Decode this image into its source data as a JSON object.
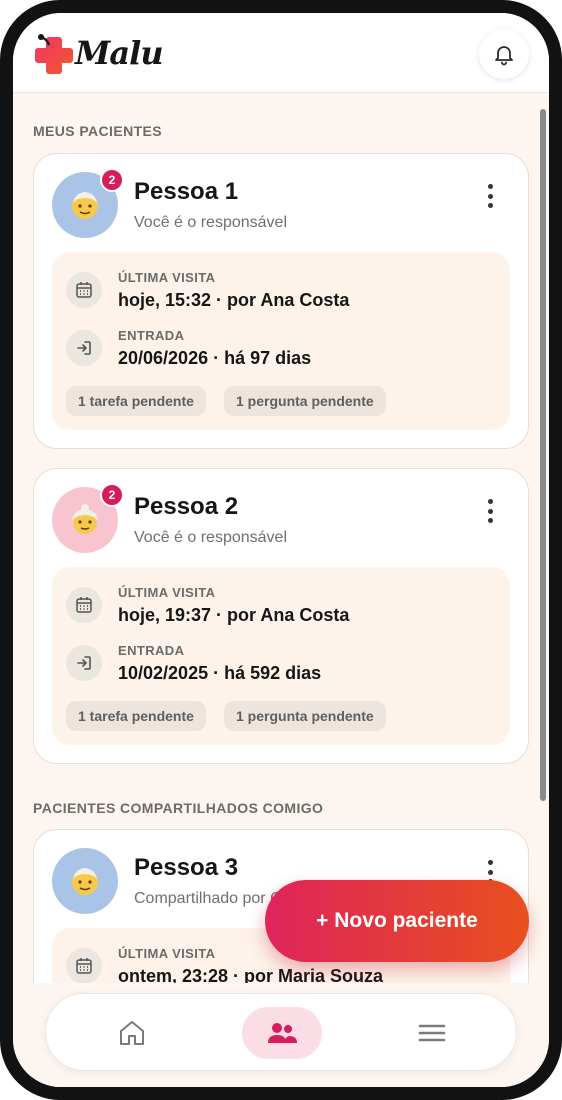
{
  "app": {
    "name": "Malu"
  },
  "sections": {
    "mine": "MEUS PACIENTES",
    "shared": "PACIENTES COMPARTILHADOS COMIGO"
  },
  "patients": [
    {
      "name": "Pessoa 1",
      "subtitle": "Você é o responsável",
      "badge": "2",
      "last_visit_label": "ÚLTIMA VISITA",
      "last_visit_value": "hoje, 15:32 · por Ana Costa",
      "entry_label": "ENTRADA",
      "entry_value": "20/06/2026 · há 97 dias",
      "chip_tasks": "1 tarefa pendente",
      "chip_questions": "1 pergunta pendente"
    },
    {
      "name": "Pessoa 2",
      "subtitle": "Você é o responsável",
      "badge": "2",
      "last_visit_label": "ÚLTIMA VISITA",
      "last_visit_value": "hoje, 19:37 · por Ana Costa",
      "entry_label": "ENTRADA",
      "entry_value": "10/02/2025 · há 592 dias",
      "chip_tasks": "1 tarefa pendente",
      "chip_questions": "1 pergunta pendente"
    },
    {
      "name": "Pessoa 3",
      "subtitle": "Compartilhado por C...",
      "last_visit_label": "ÚLTIMA VISITA",
      "last_visit_value": "ontem, 23:28 · por Maria Souza"
    }
  ],
  "fab": {
    "label": "+ Novo paciente"
  },
  "icons": {
    "bell": "bell-icon",
    "calendar": "calendar-icon",
    "entry": "login-icon",
    "home": "home-icon",
    "patients": "users-icon",
    "menu": "menu-icon"
  },
  "colors": {
    "brand": "#e0245c",
    "accent_orange": "#e9501f",
    "background": "#fdf6f0",
    "badge": "#d81b5a"
  }
}
